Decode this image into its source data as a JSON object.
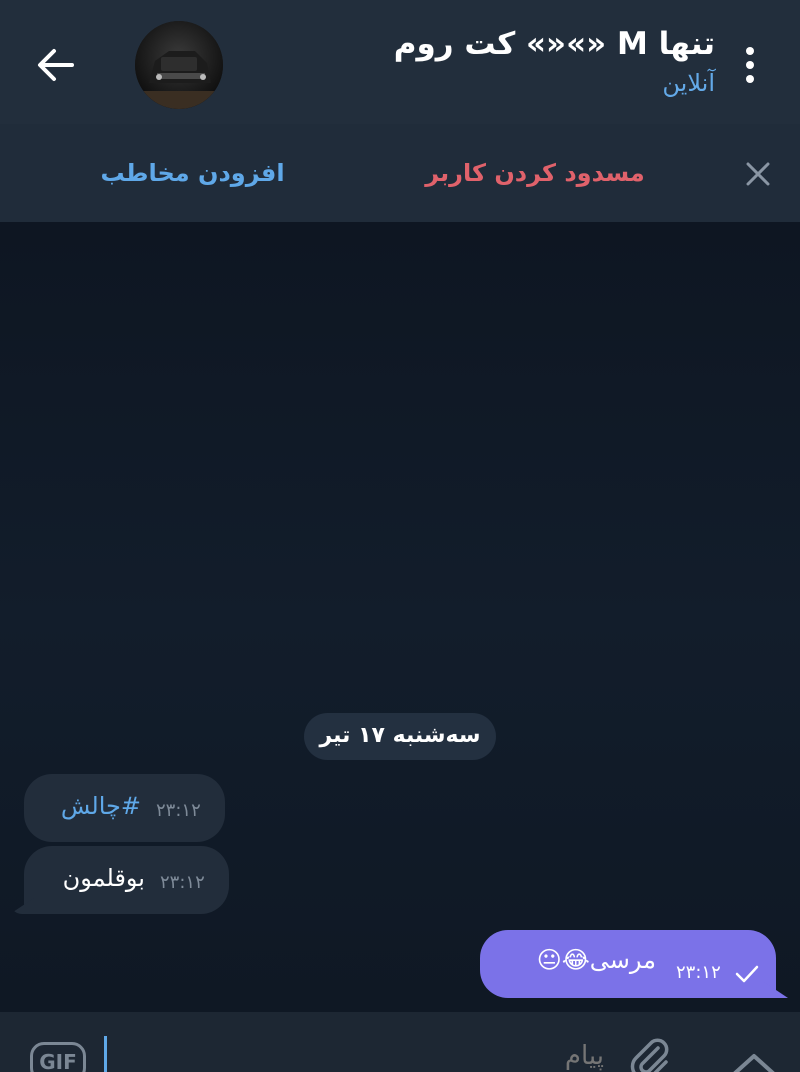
{
  "header": {
    "title": "تنها M «»«» کت روم",
    "status": "آنلاین",
    "back_icon": "arrow-left-icon",
    "menu_icon": "more-vertical-icon"
  },
  "action_bar": {
    "add_contact": "افزودن مخاطب",
    "block_user": "مسدود کردن کاربر",
    "close_icon": "close-icon"
  },
  "chat": {
    "date_separator": "سه‌شنبه ۱۷ تیر",
    "messages": [
      {
        "direction": "in",
        "text": "#چالش",
        "time": "۲۳:۱۲"
      },
      {
        "direction": "in",
        "text": "بوقلمون",
        "time": "۲۳:۱۲"
      },
      {
        "direction": "out",
        "text": "مرسی😂😐",
        "time": "۲۳:۱۲",
        "status": "sent"
      }
    ]
  },
  "composer": {
    "gif_label": "GIF",
    "placeholder": "پیام",
    "attach_icon": "paperclip-icon",
    "expand_icon": "chevron-up-icon"
  },
  "colors": {
    "header_bg": "#222e3c",
    "accent": "#5fa8e8",
    "danger": "#e0626b",
    "outgoing_bubble": "#7b72e8",
    "incoming_bubble": "#222d3b"
  }
}
